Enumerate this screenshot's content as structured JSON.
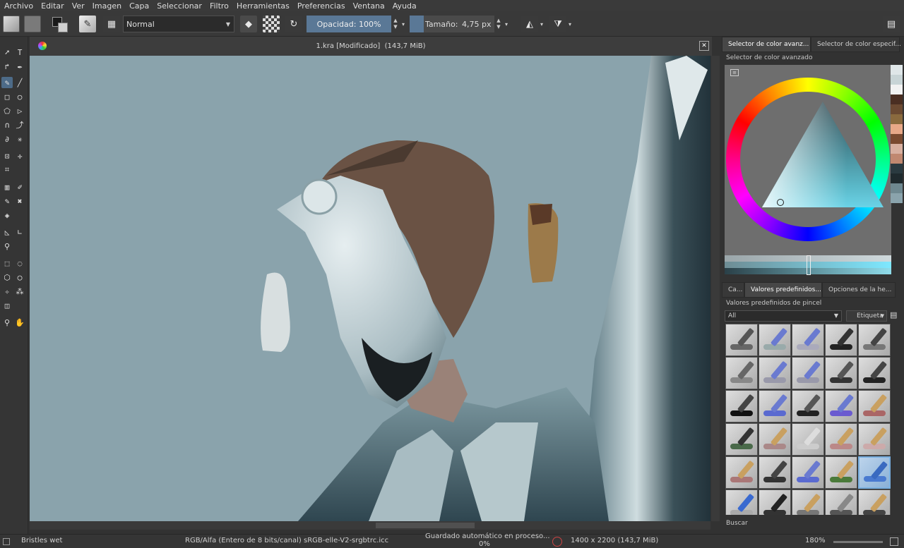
{
  "menu": [
    "Archivo",
    "Editar",
    "Ver",
    "Imagen",
    "Capa",
    "Seleccionar",
    "Filtro",
    "Herramientas",
    "Preferencias",
    "Ventana",
    "Ayuda"
  ],
  "toolbar": {
    "blend_mode": "Normal",
    "opacity_label": "Opacidad:",
    "opacity_value": "100%",
    "size_label": "Tamaño:",
    "size_value": "4,75 px"
  },
  "document": {
    "title": "1.kra [Modificado]",
    "size": "(143,7 MiB)"
  },
  "dock": {
    "color_tabs": [
      "Selector de color avanz...",
      "Selector de color especif..."
    ],
    "color_panel_title": "Selector de color avanzado",
    "preset_tabs": [
      "Ca...",
      "Valores predefinidos...",
      "Opciones de la he..."
    ],
    "preset_panel_title": "Valores predefinidos de pincel",
    "filter_value": "All",
    "tag_label": "Etiqueta",
    "search_label": "Buscar"
  },
  "status": {
    "brush": "Bristles wet",
    "colorspace": "RGB/Alfa (Entero de 8 bits/canal)  sRGB-elle-V2-srgbtrc.icc",
    "autosave": "Guardado automático en proceso...",
    "autosave_pct": "0%",
    "image_size": "1400 x 2200 (143,7 MiB)",
    "zoom": "180%"
  },
  "colors": {
    "accent": "#5a7896",
    "canvas_bg": "#8aa3ac",
    "panel": "#323232"
  }
}
